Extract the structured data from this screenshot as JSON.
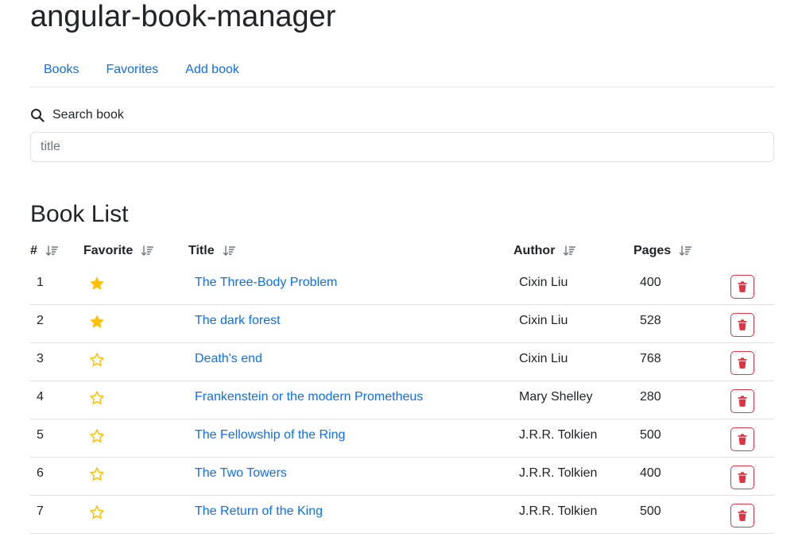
{
  "app": {
    "title": "angular-book-manager"
  },
  "nav": {
    "items": [
      "Books",
      "Favorites",
      "Add book"
    ]
  },
  "search": {
    "label": "Search book",
    "placeholder": "title",
    "value": ""
  },
  "list": {
    "heading": "Book List",
    "columns": [
      "#",
      "Favorite",
      "Title",
      "Author",
      "Pages"
    ],
    "rows": [
      {
        "id": "1",
        "favorite": true,
        "title": "The Three-Body Problem",
        "author": "Cixin Liu",
        "pages": "400"
      },
      {
        "id": "2",
        "favorite": true,
        "title": "The dark forest",
        "author": "Cixin Liu",
        "pages": "528"
      },
      {
        "id": "3",
        "favorite": false,
        "title": "Death's end",
        "author": "Cixin Liu",
        "pages": "768"
      },
      {
        "id": "4",
        "favorite": false,
        "title": "Frankenstein or the modern Prometheus",
        "author": "Mary Shelley",
        "pages": "280"
      },
      {
        "id": "5",
        "favorite": false,
        "title": "The Fellowship of the Ring",
        "author": "J.R.R. Tolkien",
        "pages": "500"
      },
      {
        "id": "6",
        "favorite": false,
        "title": "The Two Towers",
        "author": "J.R.R. Tolkien",
        "pages": "400"
      },
      {
        "id": "7",
        "favorite": false,
        "title": "The Return of the King",
        "author": "J.R.R. Tolkien",
        "pages": "500"
      }
    ]
  },
  "icons": {
    "search": "search-icon",
    "sort": "sort-descending-icon",
    "favorite_on": "star-filled-icon",
    "favorite_off": "star-outline-icon",
    "delete": "trash-icon"
  },
  "colors": {
    "link": "#0d6efd",
    "star": "#ffc107",
    "danger": "#dc3545",
    "border": "#dee2e6",
    "text": "#212529"
  }
}
